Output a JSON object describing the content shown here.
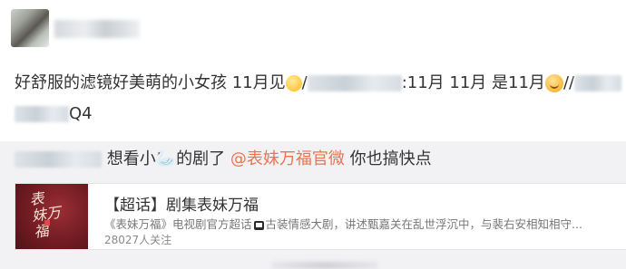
{
  "post": {
    "line1_text_a": "好舒服的滤镜好美萌的小女孩 11月见",
    "line1_slash": "/",
    "line1_text_b": ":11月 11月 是11月",
    "line1_text_c": "//",
    "line2_text": "Q4",
    "emoji_1": "smile-face-emoji",
    "emoji_2": "grin-face-emoji"
  },
  "repost": {
    "text_a": "想看小",
    "swan": "🦢",
    "text_b": "的剧了",
    "mention": "@表妹万福官微",
    "text_c": "你也搞快点"
  },
  "card": {
    "title": "【超话】剧集表妹万福",
    "desc_a": "《表妹万福》电视剧官方超话",
    "desc_b": "古装情感大剧，讲述甄嘉关在乱世浮沉中，与裴右安相知相守...",
    "followers": "28027人关注",
    "cover_art": "表\n妹万\n福"
  },
  "colors": {
    "accent_link": "#eb7350",
    "repost_bg": "#f2f2f5",
    "cover_red": "#7a1f26"
  }
}
